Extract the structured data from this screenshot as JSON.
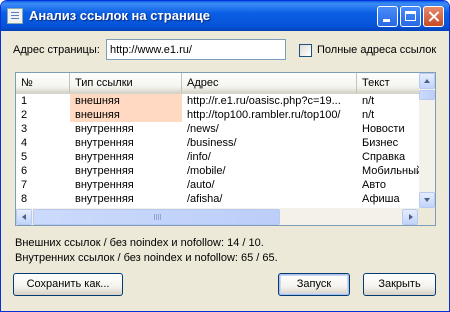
{
  "window": {
    "title": "Анализ ссылок на странице"
  },
  "url": {
    "label": "Адрес страницы:",
    "value": "http://www.e1.ru/"
  },
  "full_urls": {
    "label": "Полные адреса ссылок",
    "checked": false
  },
  "table": {
    "columns": [
      "№",
      "Тип ссылки",
      "Адрес",
      "Текст"
    ],
    "rows": [
      {
        "num": "1",
        "type": "внешняя",
        "url": "http://r.e1.ru/oasisc.php?c=19...",
        "text": "n/t",
        "external": true
      },
      {
        "num": "2",
        "type": "внешняя",
        "url": "http://top100.rambler.ru/top100/",
        "text": "n/t",
        "external": true
      },
      {
        "num": "3",
        "type": "внутренняя",
        "url": "/news/",
        "text": "Новости",
        "external": false
      },
      {
        "num": "4",
        "type": "внутренняя",
        "url": "/business/",
        "text": "Бизнес",
        "external": false
      },
      {
        "num": "5",
        "type": "внутренняя",
        "url": "/info/",
        "text": "Справка",
        "external": false
      },
      {
        "num": "6",
        "type": "внутренняя",
        "url": "/mobile/",
        "text": "Мобильный",
        "external": false
      },
      {
        "num": "7",
        "type": "внутренняя",
        "url": "/auto/",
        "text": "Авто",
        "external": false
      },
      {
        "num": "8",
        "type": "внутренняя",
        "url": "/afisha/",
        "text": "Афиша",
        "external": false
      }
    ]
  },
  "stats": {
    "external": "Внешних ссылок / без noindex и nofollow: 14 / 10.",
    "internal": "Внутренних ссылок / без noindex и nofollow: 65 / 65."
  },
  "buttons": {
    "save": "Сохранить как...",
    "run": "Запуск",
    "close": "Закрыть"
  },
  "colors": {
    "titlebar": "#0652d9",
    "external_row": "#ffd9c2",
    "window_bg": "#ece9d8"
  }
}
